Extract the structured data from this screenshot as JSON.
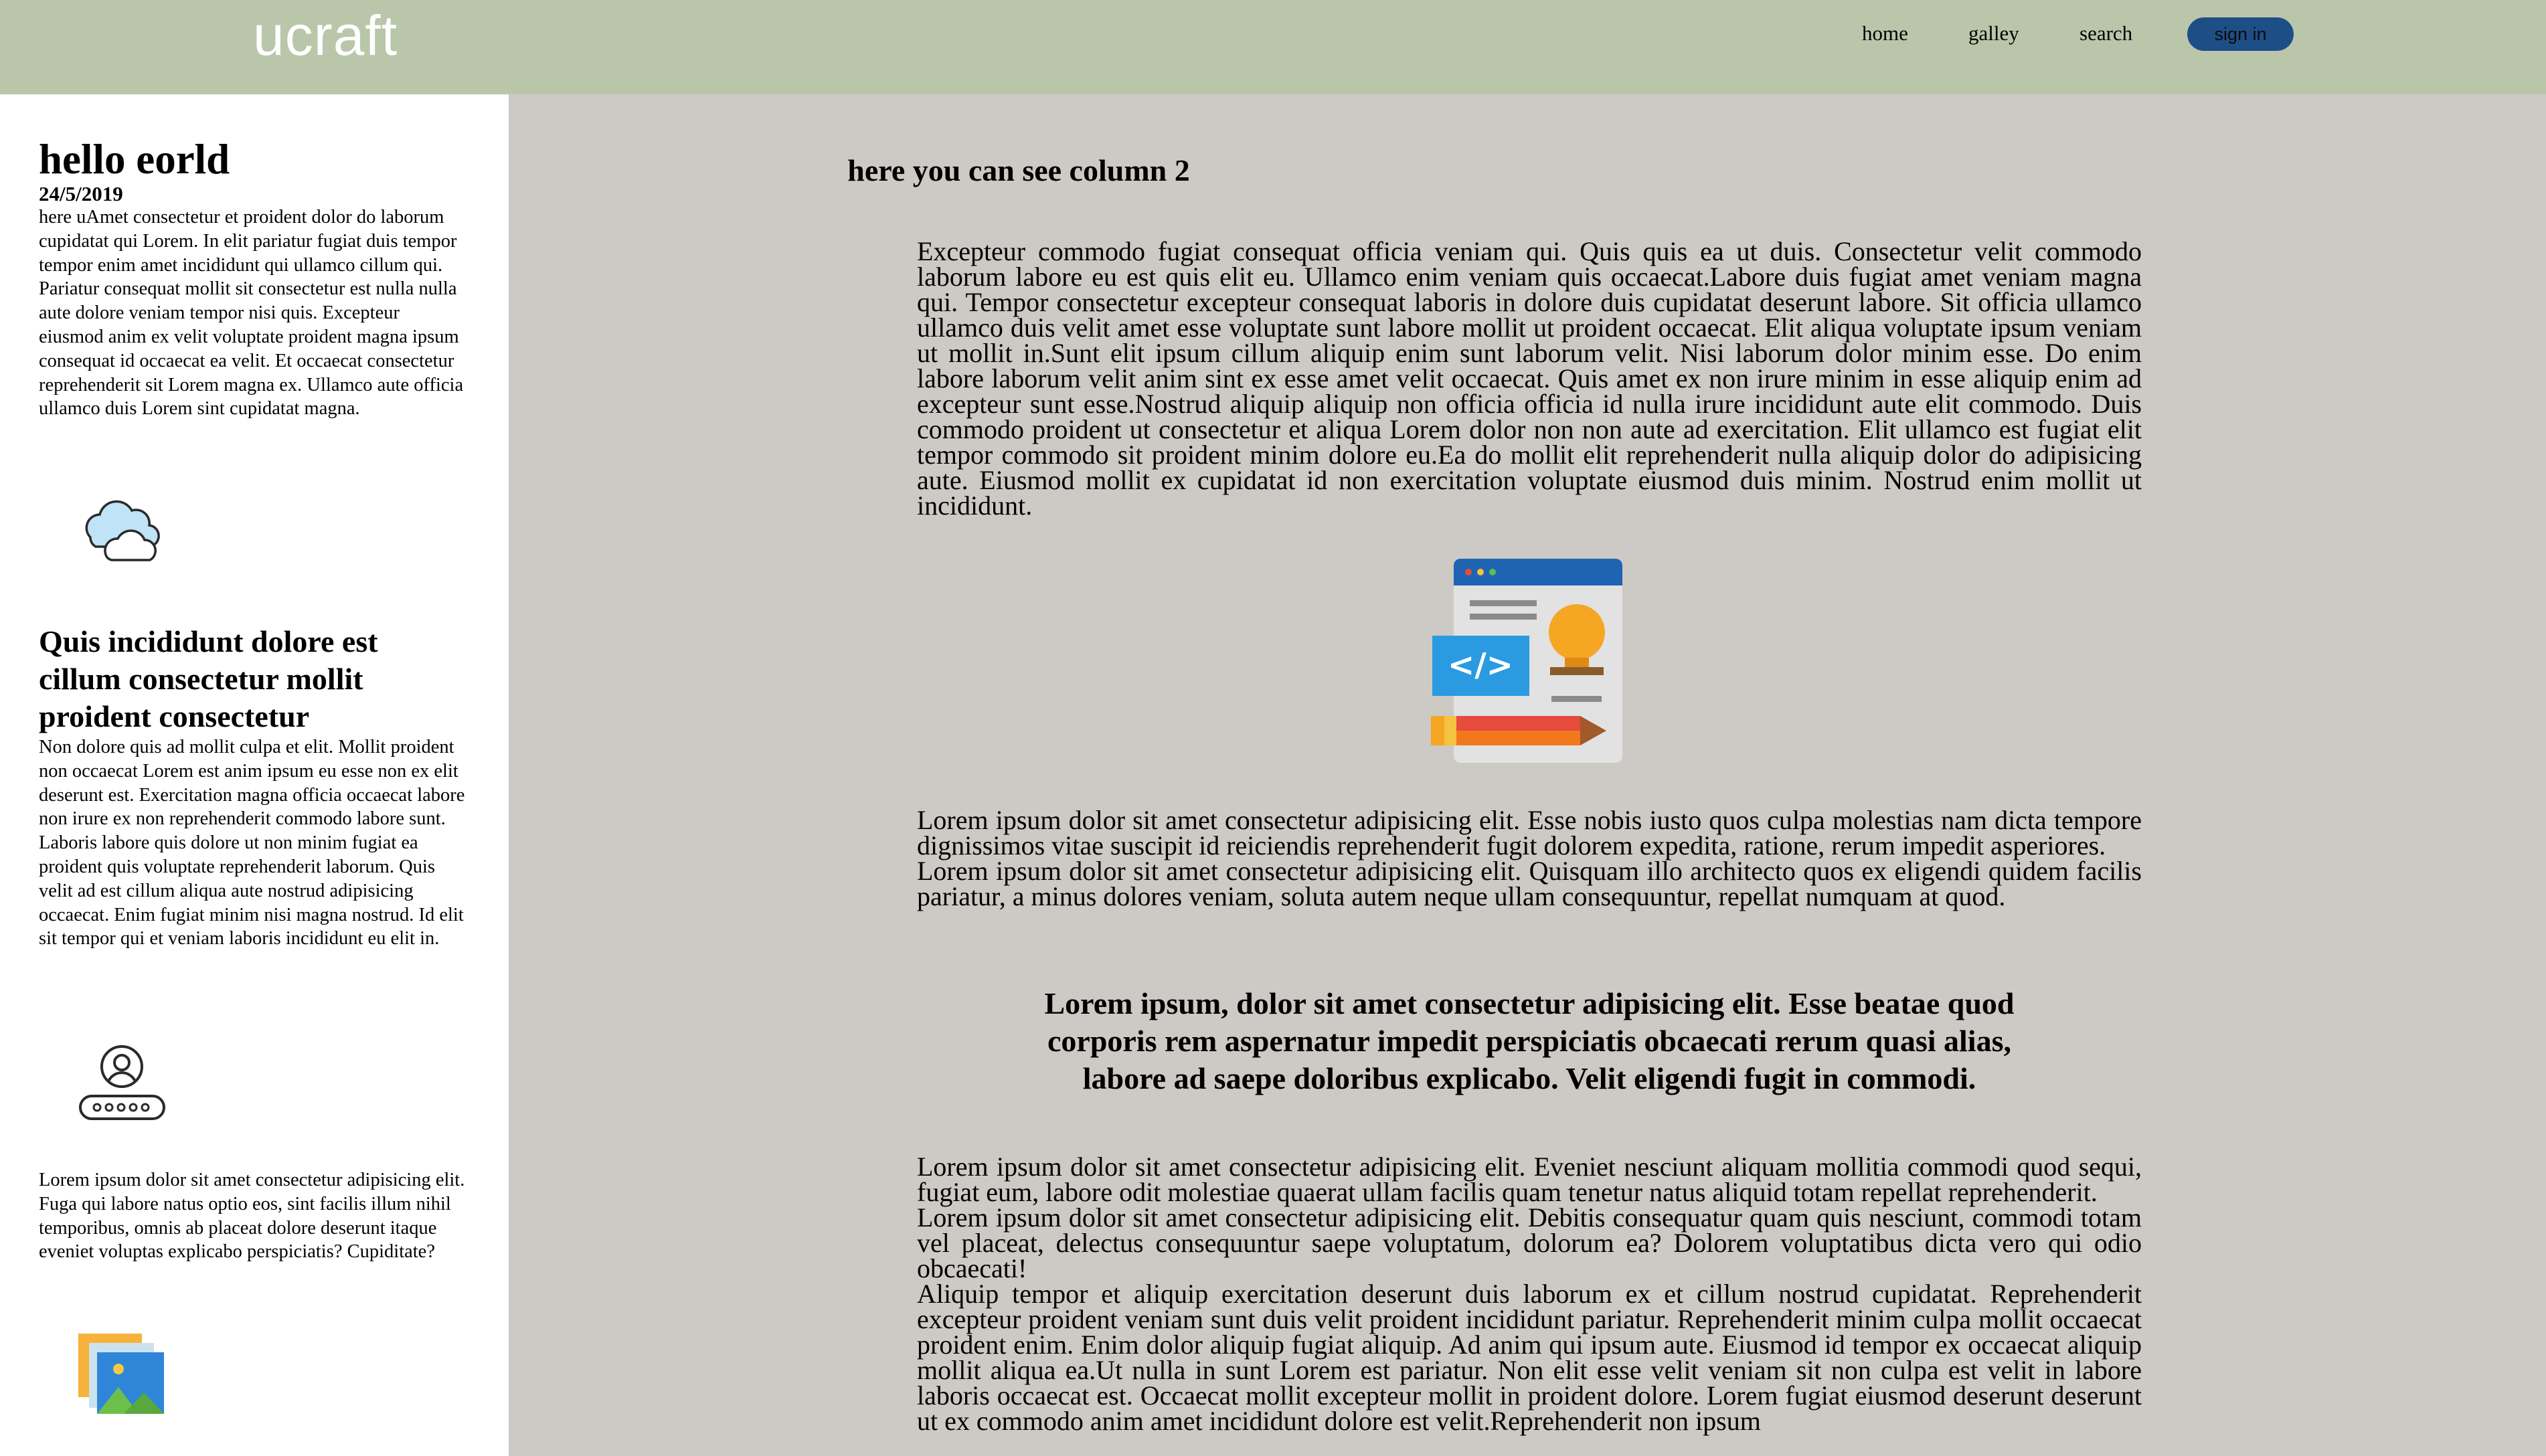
{
  "header": {
    "logo": "ucraft",
    "nav": [
      "home",
      "galley",
      "search"
    ],
    "sign_in": "sign in"
  },
  "sidebar": {
    "title": "hello eorld",
    "date": "24/5/2019",
    "intro": "here uAmet consectetur et proident dolor do laborum cupidatat qui Lorem. In elit pariatur fugiat duis tempor tempor enim amet incididunt qui ullamco cillum qui. Pariatur consequat mollit sit consectetur est nulla nulla aute dolore veniam tempor nisi quis. Excepteur eiusmod anim ex velit voluptate proident magna ipsum consequat id occaecat ea velit. Et occaecat consectetur reprehenderit sit Lorem magna ex. Ullamco aute officia ullamco duis Lorem sint cupidatat magna.",
    "heading2": "Quis incididunt dolore est cillum consectetur mollit proident consectetur",
    "body2": "Non dolore quis ad mollit culpa et elit. Mollit proident non occaecat Lorem est anim ipsum eu esse non ex elit deserunt est. Exercitation magna officia occaecat labore non irure ex non reprehenderit commodo labore sunt. Laboris labore quis dolore ut non minim fugiat ea proident quis voluptate reprehenderit laborum. Quis velit ad est cillum aliqua aute nostrud adipisicing occaecat. Enim fugiat minim nisi magna nostrud. Id elit sit tempor qui et veniam laboris incididunt eu elit in.",
    "body3": "Lorem ipsum dolor sit amet consectetur adipisicing elit. Fuga qui labore natus optio eos, sint facilis illum nihil temporibus, omnis ab placeat dolore deserunt itaque eveniet voluptas explicabo perspiciatis? Cupiditate?",
    "icons": [
      "cloud-icon",
      "user-password-icon",
      "gallery-icon"
    ]
  },
  "main": {
    "title": "here you can see column 2",
    "para1": "Excepteur commodo fugiat consequat officia veniam qui. Quis quis ea ut duis. Consectetur velit commodo laborum labore eu est quis elit eu. Ullamco enim veniam quis occaecat.Labore duis fugiat amet veniam magna qui. Tempor consectetur excepteur consequat laboris in dolore duis cupidatat deserunt labore. Sit officia ullamco ullamco duis velit amet esse voluptate sunt labore mollit ut proident occaecat. Elit aliqua voluptate ipsum veniam ut mollit in.Sunt elit ipsum cillum aliquip enim sunt laborum velit. Nisi laborum dolor minim esse. Do enim labore laborum velit anim sint ex esse amet velit occaecat. Quis amet ex non irure minim in esse aliquip enim ad excepteur sunt esse.Nostrud aliquip aliquip non officia officia id nulla irure incididunt aute elit commodo. Duis commodo proident ut consectetur et aliqua Lorem dolor non non aute ad exercitation. Elit ullamco est fugiat elit tempor commodo sit proident minim dolore eu.Ea do mollit elit reprehenderit nulla aliquip dolor do adipisicing aute. Eiusmod mollit ex cupidatat id non exercitation voluptate eiusmod duis minim. Nostrud enim mollit ut incididunt.",
    "para2a": "Lorem ipsum dolor sit amet consectetur adipisicing elit. Esse nobis iusto quos culpa molestias nam dicta tempore dignissimos vitae suscipit id reiciendis reprehenderit fugit dolorem expedita, ratione, rerum impedit asperiores.",
    "para2b": "Lorem ipsum dolor sit amet consectetur adipisicing elit. Quisquam illo architecto quos ex eligendi quidem facilis pariatur, a minus dolores veniam, soluta autem neque ullam consequuntur, repellat numquam at quod.",
    "quote": "Lorem ipsum, dolor sit amet consectetur adipisicing elit. Esse beatae quod corporis rem aspernatur impedit perspiciatis obcaecati rerum quasi alias, labore ad saepe doloribus explicabo. Velit eligendi fugit in commodi.",
    "para3a": "Lorem ipsum dolor sit amet consectetur adipisicing elit. Eveniet nesciunt aliquam mollitia commodi quod sequi, fugiat eum, labore odit molestiae quaerat ullam facilis quam tenetur natus aliquid totam repellat reprehenderit.",
    "para3b": "Lorem ipsum dolor sit amet consectetur adipisicing elit. Debitis consequatur quam quis nesciunt, commodi totam vel placeat, delectus consequuntur saepe voluptatum, dolorum ea? Dolorem voluptatibus dicta vero qui odio obcaecati!",
    "para3c": "Aliquip tempor et aliquip exercitation deserunt duis laborum ex et cillum nostrud cupidatat. Reprehenderit excepteur proident veniam sunt duis velit proident incididunt pariatur. Reprehenderit minim culpa mollit occaecat proident enim. Enim dolor aliquip fugiat aliquip. Ad anim qui ipsum aute. Eiusmod id tempor ex occaecat aliquip mollit aliqua ea.Ut nulla in sunt Lorem est pariatur. Non elit esse velit veniam sit non culpa est velit in labore laboris occaecat est. Occaecat mollit excepteur mollit in proident dolore. Lorem fugiat eiusmod deserunt deserunt ut ex commodo anim amet incididunt dolore est velit.Reprehenderit non ipsum",
    "illustration": "web-development-icon"
  }
}
